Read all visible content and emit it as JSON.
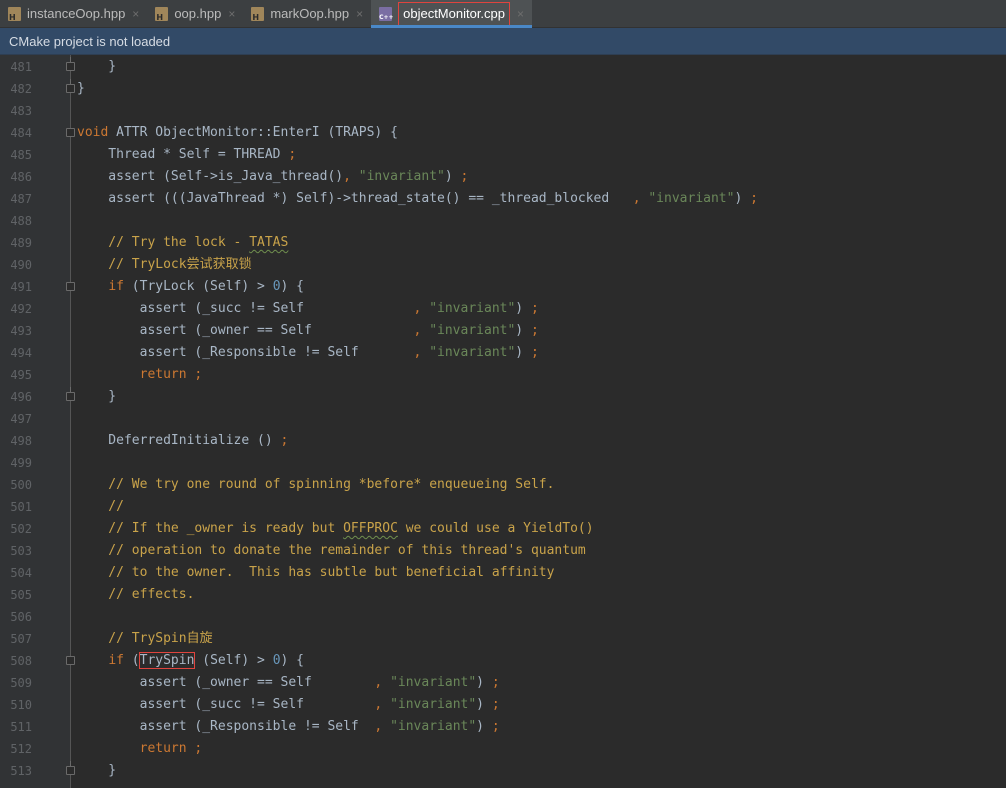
{
  "tabs": [
    {
      "label": "instanceOop.hpp",
      "type": "hpp",
      "active": false
    },
    {
      "label": "oop.hpp",
      "type": "hpp",
      "active": false
    },
    {
      "label": "markOop.hpp",
      "type": "hpp",
      "active": false
    },
    {
      "label": "objectMonitor.cpp",
      "type": "cpp",
      "active": true
    }
  ],
  "tab_close_glyph": "×",
  "banner": {
    "text": "CMake project is not loaded"
  },
  "editor": {
    "lines": [
      {
        "n": "481",
        "fold": "end",
        "tokens": [
          [
            "p",
            "    }"
          ]
        ]
      },
      {
        "n": "482",
        "fold": "end",
        "tokens": [
          [
            "p",
            "}"
          ]
        ]
      },
      {
        "n": "483",
        "tokens": []
      },
      {
        "n": "484",
        "fold": "start",
        "tokens": [
          [
            "kw",
            "void"
          ],
          [
            "p",
            " ATTR ObjectMonitor::EnterI (TRAPS) {"
          ]
        ]
      },
      {
        "n": "485",
        "tokens": [
          [
            "p",
            "    Thread * Self = THREAD "
          ],
          [
            "kw",
            ";"
          ]
        ]
      },
      {
        "n": "486",
        "tokens": [
          [
            "p",
            "    assert (Self->is_Java_thread()"
          ],
          [
            "kw",
            ","
          ],
          [
            "p",
            " "
          ],
          [
            "str",
            "\"invariant\""
          ],
          [
            "p",
            ") "
          ],
          [
            "kw",
            ";"
          ]
        ]
      },
      {
        "n": "487",
        "tokens": [
          [
            "p",
            "    assert (((JavaThread *) Self)->thread_state() == _thread_blocked   "
          ],
          [
            "kw",
            ","
          ],
          [
            "p",
            " "
          ],
          [
            "str",
            "\"invariant\""
          ],
          [
            "p",
            ") "
          ],
          [
            "kw",
            ";"
          ]
        ]
      },
      {
        "n": "488",
        "tokens": []
      },
      {
        "n": "489",
        "tokens": [
          [
            "c",
            "    // Try the lock - "
          ],
          [
            "cs",
            "TATAS"
          ]
        ]
      },
      {
        "n": "490",
        "tokens": [
          [
            "c",
            "    // TryLock尝试获取锁"
          ]
        ]
      },
      {
        "n": "491",
        "fold": "start",
        "tokens": [
          [
            "p",
            "    "
          ],
          [
            "kw",
            "if"
          ],
          [
            "p",
            " (TryLock (Self) > "
          ],
          [
            "num",
            "0"
          ],
          [
            "p",
            ") {"
          ]
        ]
      },
      {
        "n": "492",
        "tokens": [
          [
            "p",
            "        assert (_succ != Self              "
          ],
          [
            "kw",
            ","
          ],
          [
            "p",
            " "
          ],
          [
            "str",
            "\"invariant\""
          ],
          [
            "p",
            ") "
          ],
          [
            "kw",
            ";"
          ]
        ]
      },
      {
        "n": "493",
        "tokens": [
          [
            "p",
            "        assert (_owner == Self             "
          ],
          [
            "kw",
            ","
          ],
          [
            "p",
            " "
          ],
          [
            "str",
            "\"invariant\""
          ],
          [
            "p",
            ") "
          ],
          [
            "kw",
            ";"
          ]
        ]
      },
      {
        "n": "494",
        "tokens": [
          [
            "p",
            "        assert (_Responsible != Self       "
          ],
          [
            "kw",
            ","
          ],
          [
            "p",
            " "
          ],
          [
            "str",
            "\"invariant\""
          ],
          [
            "p",
            ") "
          ],
          [
            "kw",
            ";"
          ]
        ]
      },
      {
        "n": "495",
        "tokens": [
          [
            "p",
            "        "
          ],
          [
            "kw",
            "return ;"
          ]
        ]
      },
      {
        "n": "496",
        "fold": "end",
        "tokens": [
          [
            "p",
            "    }"
          ]
        ]
      },
      {
        "n": "497",
        "tokens": []
      },
      {
        "n": "498",
        "tokens": [
          [
            "p",
            "    DeferredInitialize () "
          ],
          [
            "kw",
            ";"
          ]
        ]
      },
      {
        "n": "499",
        "tokens": []
      },
      {
        "n": "500",
        "tokens": [
          [
            "c",
            "    // We try one round of spinning *before* enqueueing Self."
          ]
        ]
      },
      {
        "n": "501",
        "tokens": [
          [
            "c",
            "    //"
          ]
        ]
      },
      {
        "n": "502",
        "tokens": [
          [
            "c",
            "    // If the _owner is ready but "
          ],
          [
            "cs",
            "OFFPROC"
          ],
          [
            "c",
            " we could use a YieldTo()"
          ]
        ]
      },
      {
        "n": "503",
        "tokens": [
          [
            "c",
            "    // operation to donate the remainder of this thread's quantum"
          ]
        ]
      },
      {
        "n": "504",
        "tokens": [
          [
            "c",
            "    // to the owner.  This has subtle but beneficial affinity"
          ]
        ]
      },
      {
        "n": "505",
        "tokens": [
          [
            "c",
            "    // effects."
          ]
        ]
      },
      {
        "n": "506",
        "tokens": []
      },
      {
        "n": "507",
        "tokens": [
          [
            "c",
            "    // TrySpin自旋"
          ]
        ]
      },
      {
        "n": "508",
        "fold": "start",
        "tokens": [
          [
            "p",
            "    "
          ],
          [
            "kw",
            "if"
          ],
          [
            "p",
            " ("
          ],
          [
            "box",
            "TrySpin"
          ],
          [
            "p",
            " (Self) > "
          ],
          [
            "num",
            "0"
          ],
          [
            "p",
            ") {"
          ]
        ]
      },
      {
        "n": "509",
        "tokens": [
          [
            "p",
            "        assert (_owner == Self        "
          ],
          [
            "kw",
            ","
          ],
          [
            "p",
            " "
          ],
          [
            "str",
            "\"invariant\""
          ],
          [
            "p",
            ") "
          ],
          [
            "kw",
            ";"
          ]
        ]
      },
      {
        "n": "510",
        "tokens": [
          [
            "p",
            "        assert (_succ != Self         "
          ],
          [
            "kw",
            ","
          ],
          [
            "p",
            " "
          ],
          [
            "str",
            "\"invariant\""
          ],
          [
            "p",
            ") "
          ],
          [
            "kw",
            ";"
          ]
        ]
      },
      {
        "n": "511",
        "tokens": [
          [
            "p",
            "        assert (_Responsible != Self  "
          ],
          [
            "kw",
            ","
          ],
          [
            "p",
            " "
          ],
          [
            "str",
            "\"invariant\""
          ],
          [
            "p",
            ") "
          ],
          [
            "kw",
            ";"
          ]
        ]
      },
      {
        "n": "512",
        "tokens": [
          [
            "p",
            "        "
          ],
          [
            "kw",
            "return ;"
          ]
        ]
      },
      {
        "n": "513",
        "fold": "end",
        "tokens": [
          [
            "p",
            "    }"
          ]
        ]
      }
    ]
  },
  "colors": {
    "keyword": "#cc7832",
    "string": "#6a8759",
    "number": "#6897bb",
    "comment": "#c9a34a",
    "text": "#a9b7c6",
    "highlight_box": "#e0443e",
    "active_tab_underline": "#4a88c7",
    "banner_bg": "#324a67"
  }
}
